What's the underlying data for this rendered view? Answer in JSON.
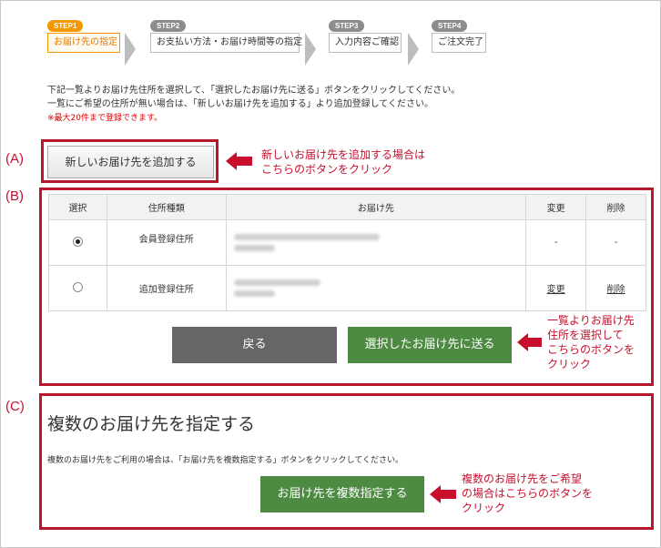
{
  "steps": [
    {
      "badge": "STEP1",
      "label": "お届け先の指定"
    },
    {
      "badge": "STEP2",
      "label": "お支払い方法・お届け時間等の指定"
    },
    {
      "badge": "STEP3",
      "label": "入力内容ご確認"
    },
    {
      "badge": "STEP4",
      "label": "ご注文完了"
    }
  ],
  "instructions": {
    "line1": "下記一覧よりお届け先住所を選択して、「選択したお届け先に送る」ボタンをクリックしてください。",
    "line2": "一覧にご希望の住所が無い場合は、「新しいお届け先を追加する」より追加登録してください。",
    "note": "※最大20件まで登録できます。"
  },
  "labels": {
    "a": "(A)",
    "b": "(B)",
    "c": "(C)"
  },
  "add_button": "新しいお届け先を追加する",
  "callout_a": {
    "line1": "新しいお届け先を追加する場合は",
    "line2": "こちらのボタンをクリック"
  },
  "table": {
    "headers": {
      "select": "選択",
      "type": "住所種類",
      "dest": "お届け先",
      "edit": "変更",
      "delete": "削除"
    },
    "rows": [
      {
        "type": "会員登録住所",
        "edit": "-",
        "delete": "-"
      },
      {
        "type": "追加登録住所",
        "edit": "変更",
        "delete": "削除"
      }
    ]
  },
  "back_button": "戻る",
  "send_button": "選択したお届け先に送る",
  "callout_b": {
    "line1": "一覧よりお届け先",
    "line2": "住所を選択して",
    "line3": "こちらのボタンを",
    "line4": "クリック"
  },
  "multi": {
    "title": "複数のお届け先を指定する",
    "desc": "複数のお届け先をご利用の場合は、「お届け先を複数指定する」ボタンをクリックしてください。",
    "button": "お届け先を複数指定する"
  },
  "callout_c": {
    "line1": "複数のお届け先をご希望",
    "line2": "の場合はこちらのボタンを",
    "line3": "クリック"
  },
  "colors": {
    "accent": "#f39800",
    "annotation": "#c8102e",
    "green": "#4d8a42",
    "back": "#666666"
  }
}
